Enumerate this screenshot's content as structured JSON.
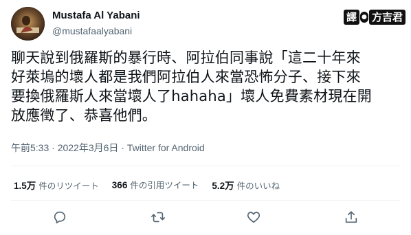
{
  "author": {
    "display_name": "Mustafa Al Yabani",
    "handle": "@mustafaalyabani"
  },
  "watermark": {
    "left": "譯",
    "right": "方吉君"
  },
  "tweet": {
    "lines": [
      "聊天說到俄羅斯的暴行時、阿拉伯同事說「這二十年來",
      "好萊塢的壞人都是我們阿拉伯人來當恐怖分子、接下來",
      "要換俄羅斯人來當壞人了hahaha」壞人免費素材現在開",
      "放應徵了、恭喜他們。"
    ]
  },
  "meta": {
    "timestamp": "午前5:33 · 2022年3月6日 · Twitter for Android"
  },
  "stats": {
    "retweets": {
      "count": "1.5万",
      "label": "件のリツイート"
    },
    "quotes": {
      "count": "366",
      "label": "件の引用ツイート"
    },
    "likes": {
      "count": "5.2万",
      "label": "件のいいね"
    }
  },
  "icons": {
    "reply": "reply-icon",
    "retweet": "retweet-icon",
    "like": "heart-icon",
    "share": "share-icon"
  },
  "colors": {
    "text": "#0f1419",
    "secondary": "#536471",
    "divider": "#eff3f4"
  }
}
